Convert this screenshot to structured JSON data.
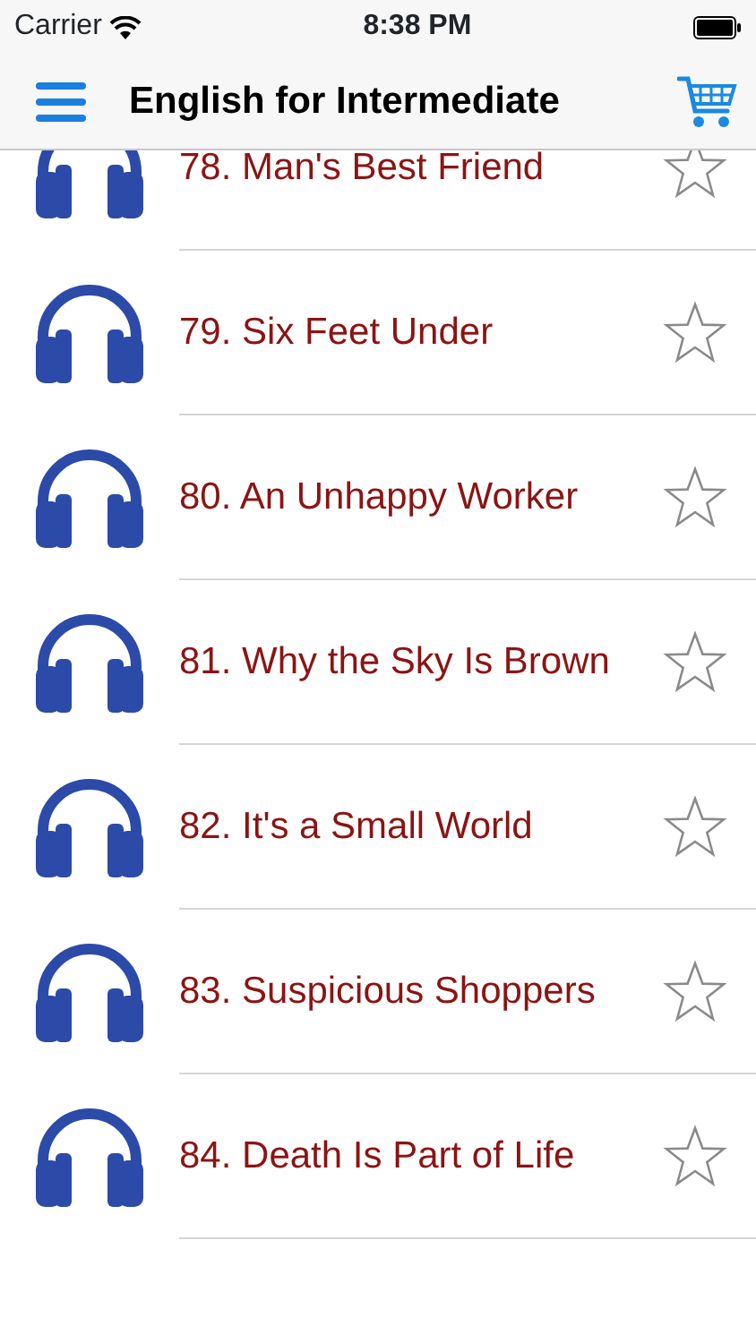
{
  "status_bar": {
    "carrier": "Carrier",
    "time": "8:38 PM"
  },
  "navbar": {
    "title": "English for Intermediate"
  },
  "lessons": [
    {
      "title": "78. Man's Best Friend",
      "starred": false
    },
    {
      "title": "79. Six Feet Under",
      "starred": false
    },
    {
      "title": "80. An Unhappy Worker",
      "starred": false
    },
    {
      "title": "81. Why the Sky Is Brown",
      "starred": false
    },
    {
      "title": "82. It's a Small World",
      "starred": false
    },
    {
      "title": "83. Suspicious Shoppers",
      "starred": false
    },
    {
      "title": "84. Death Is Part of Life",
      "starred": false
    }
  ]
}
